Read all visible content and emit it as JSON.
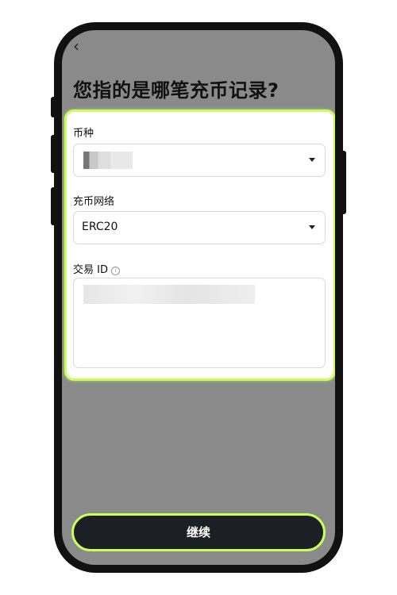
{
  "header": {
    "back_icon": "chevron-left-icon",
    "title": "您指的是哪笔充币记录?"
  },
  "form": {
    "currency": {
      "label": "币种",
      "value": ""
    },
    "network": {
      "label": "充币网络",
      "value": "ERC20"
    },
    "txid": {
      "label": "交易 ID",
      "info_icon": "info-icon",
      "value": ""
    }
  },
  "footer": {
    "continue_label": "继续"
  },
  "colors": {
    "accent": "#c9ff5a",
    "screen_bg": "#8a8a8a",
    "button_bg": "#1c1f23"
  }
}
